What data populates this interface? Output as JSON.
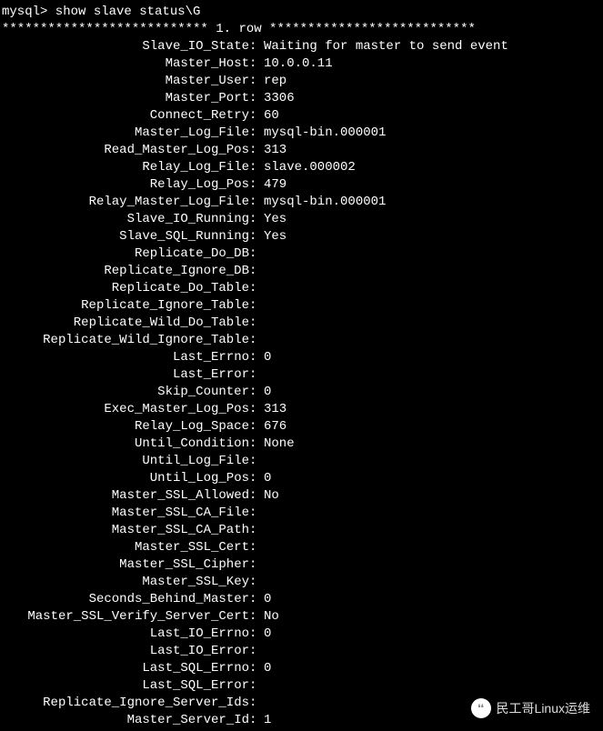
{
  "prompt": "mysql> show slave status\\G",
  "row_header": "*************************** 1. row ***************************",
  "fields": [
    {
      "key": "Slave_IO_State",
      "value": "Waiting for master to send event"
    },
    {
      "key": "Master_Host",
      "value": "10.0.0.11"
    },
    {
      "key": "Master_User",
      "value": "rep"
    },
    {
      "key": "Master_Port",
      "value": "3306"
    },
    {
      "key": "Connect_Retry",
      "value": "60"
    },
    {
      "key": "Master_Log_File",
      "value": "mysql-bin.000001"
    },
    {
      "key": "Read_Master_Log_Pos",
      "value": "313"
    },
    {
      "key": "Relay_Log_File",
      "value": "slave.000002"
    },
    {
      "key": "Relay_Log_Pos",
      "value": "479"
    },
    {
      "key": "Relay_Master_Log_File",
      "value": "mysql-bin.000001"
    },
    {
      "key": "Slave_IO_Running",
      "value": "Yes"
    },
    {
      "key": "Slave_SQL_Running",
      "value": "Yes"
    },
    {
      "key": "Replicate_Do_DB",
      "value": ""
    },
    {
      "key": "Replicate_Ignore_DB",
      "value": ""
    },
    {
      "key": "Replicate_Do_Table",
      "value": ""
    },
    {
      "key": "Replicate_Ignore_Table",
      "value": ""
    },
    {
      "key": "Replicate_Wild_Do_Table",
      "value": ""
    },
    {
      "key": "Replicate_Wild_Ignore_Table",
      "value": ""
    },
    {
      "key": "Last_Errno",
      "value": "0"
    },
    {
      "key": "Last_Error",
      "value": ""
    },
    {
      "key": "Skip_Counter",
      "value": "0"
    },
    {
      "key": "Exec_Master_Log_Pos",
      "value": "313"
    },
    {
      "key": "Relay_Log_Space",
      "value": "676"
    },
    {
      "key": "Until_Condition",
      "value": "None"
    },
    {
      "key": "Until_Log_File",
      "value": ""
    },
    {
      "key": "Until_Log_Pos",
      "value": "0"
    },
    {
      "key": "Master_SSL_Allowed",
      "value": "No"
    },
    {
      "key": "Master_SSL_CA_File",
      "value": ""
    },
    {
      "key": "Master_SSL_CA_Path",
      "value": ""
    },
    {
      "key": "Master_SSL_Cert",
      "value": ""
    },
    {
      "key": "Master_SSL_Cipher",
      "value": ""
    },
    {
      "key": "Master_SSL_Key",
      "value": ""
    },
    {
      "key": "Seconds_Behind_Master",
      "value": "0"
    },
    {
      "key": "Master_SSL_Verify_Server_Cert",
      "value": "No"
    },
    {
      "key": "Last_IO_Errno",
      "value": "0"
    },
    {
      "key": "Last_IO_Error",
      "value": ""
    },
    {
      "key": "Last_SQL_Errno",
      "value": "0"
    },
    {
      "key": "Last_SQL_Error",
      "value": ""
    },
    {
      "key": "Replicate_Ignore_Server_Ids",
      "value": ""
    },
    {
      "key": "Master_Server_Id",
      "value": "1"
    }
  ],
  "watermark": {
    "icon_text": "❛❛",
    "label": "民工哥Linux运维"
  }
}
